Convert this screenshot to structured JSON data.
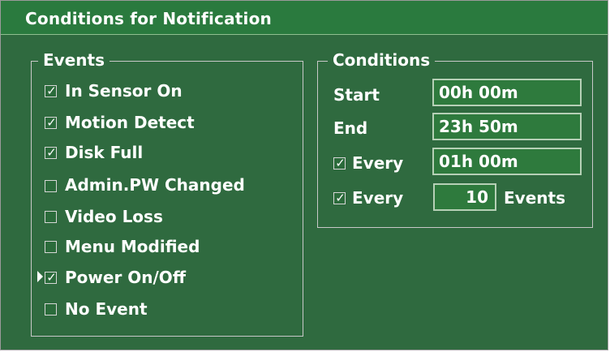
{
  "window": {
    "title": "Conditions for Notification"
  },
  "events": {
    "legend": "Events",
    "items": [
      {
        "label": "In Sensor On",
        "checked": true
      },
      {
        "label": "Motion Detect",
        "checked": true
      },
      {
        "label": "Disk Full",
        "checked": true
      },
      {
        "label": "Admin.PW Changed",
        "checked": false
      },
      {
        "label": "Video Loss",
        "checked": false
      },
      {
        "label": "Menu Modified",
        "checked": false
      },
      {
        "label": "Power On/Off",
        "checked": true
      },
      {
        "label": "No Event",
        "checked": false
      }
    ],
    "focused_index": 6
  },
  "conditions": {
    "legend": "Conditions",
    "start_label": "Start",
    "start_value": "00h 00m",
    "end_label": "End",
    "end_value": "23h 50m",
    "every_time_label": "Every",
    "every_time_checked": true,
    "every_time_value": "01h 00m",
    "every_events_label": "Every",
    "every_events_checked": true,
    "every_events_value": "10",
    "events_unit": "Events"
  },
  "colors": {
    "panel": "#2f6a3f",
    "titlebar": "#2a7a3e",
    "field": "#2e7a3d",
    "text": "#ffffff"
  },
  "icons": {
    "checkbox_mark": "✓",
    "focus_pointer": "triangle-right"
  }
}
